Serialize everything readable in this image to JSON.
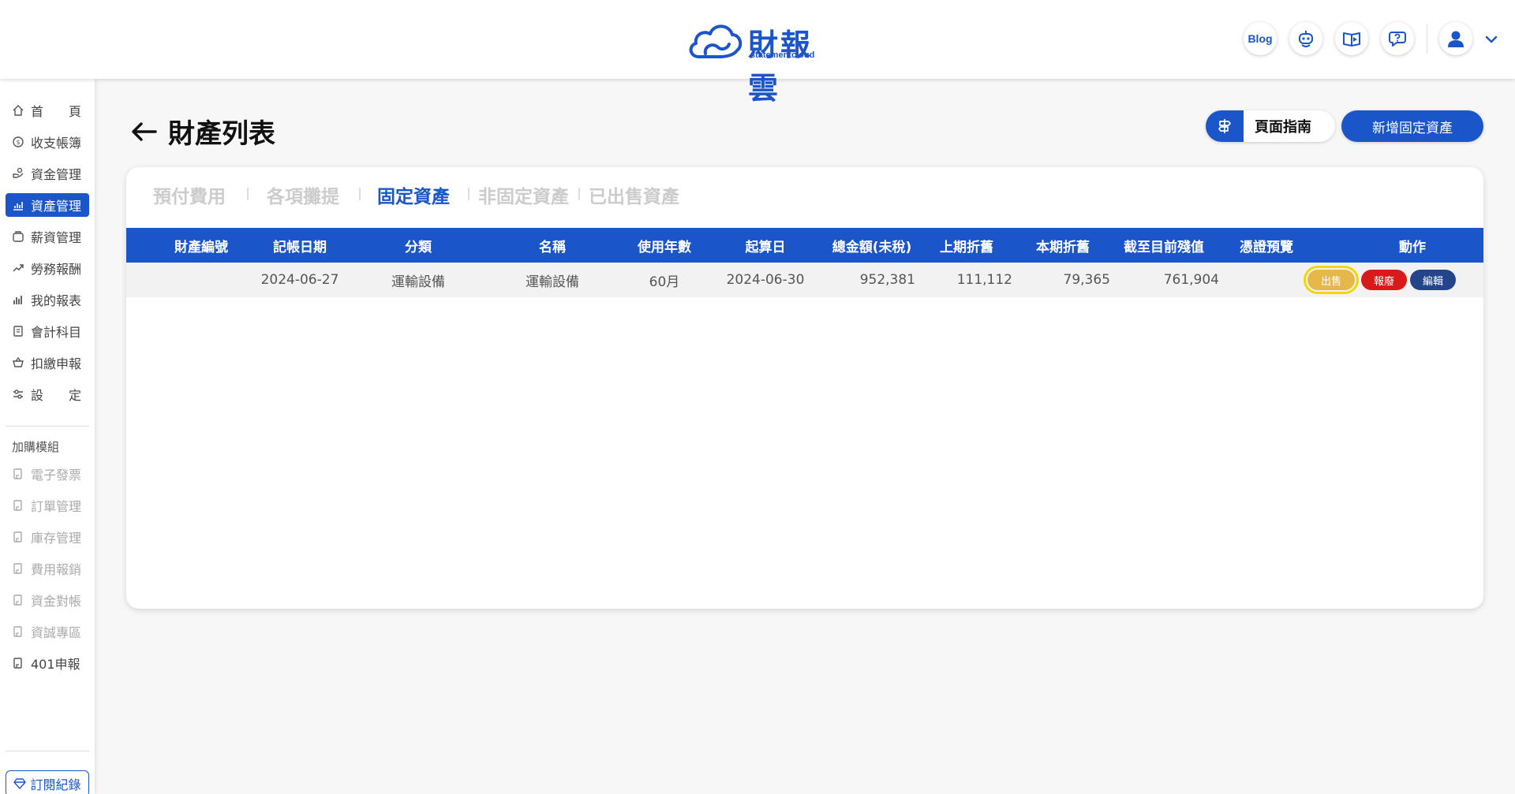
{
  "header": {
    "logo_cn": "財報雲",
    "logo_en": "statementcloud",
    "blog_label": "Blog",
    "icons": [
      "robot-icon",
      "video-book-icon",
      "help-chat-icon",
      "user-avatar-icon",
      "chevron-down-icon"
    ]
  },
  "sidebar": {
    "items": [
      {
        "label_a": "首",
        "label_b": "頁",
        "icon": "home-icon"
      },
      {
        "label": "收支帳簿",
        "icon": "coin-icon"
      },
      {
        "label": "資金管理",
        "icon": "hand-money-icon"
      },
      {
        "label": "資產管理",
        "icon": "chart-icon",
        "active": true
      },
      {
        "label": "薪資管理",
        "icon": "wallet-icon"
      },
      {
        "label": "勞務報酬",
        "icon": "handshake-icon"
      },
      {
        "label": "我的報表",
        "icon": "bar-chart-icon"
      },
      {
        "label": "會計科目",
        "icon": "ledger-icon"
      },
      {
        "label": "扣繳申報",
        "icon": "basket-icon"
      },
      {
        "label_a": "設",
        "label_b": "定",
        "icon": "sliders-icon"
      }
    ],
    "addon_title": "加購模組",
    "addons": [
      {
        "label": "電子發票"
      },
      {
        "label": "訂單管理"
      },
      {
        "label": "庫存管理"
      },
      {
        "label": "費用報銷"
      },
      {
        "label": "資金對帳"
      },
      {
        "label": "資誠專區"
      },
      {
        "label": "401申報"
      }
    ],
    "subscription_label": "訂閱紀錄"
  },
  "page": {
    "title": "財產列表",
    "guide_label": "頁面指南",
    "add_label": "新增固定資產"
  },
  "tabs": [
    {
      "label": "預付費用"
    },
    {
      "label": "各項攤提"
    },
    {
      "label": "固定資產",
      "active": true
    },
    {
      "label": "非固定資產"
    },
    {
      "label": "已出售資產"
    }
  ],
  "table": {
    "columns": [
      "財產編號",
      "記帳日期",
      "分類",
      "名稱",
      "使用年數",
      "起算日",
      "總金額(未稅)",
      "上期折舊",
      "本期折舊",
      "截至目前殘值",
      "憑證預覽",
      "動作"
    ],
    "rows": [
      {
        "asset_no": "",
        "entry_date": "2024-06-27",
        "category": "運輸設備",
        "name": "運輸設備",
        "years": "60月",
        "start_date": "2024-06-30",
        "total": "952,381",
        "prev_dep": "111,112",
        "cur_dep": "79,365",
        "residual": "761,904",
        "voucher": "",
        "actions": {
          "sell": "出售",
          "scrap": "報廢",
          "edit": "編輯"
        }
      }
    ]
  },
  "colors": {
    "primary": "#1a55c9",
    "sell": "#e6b84a",
    "scrap": "#d81a1a",
    "edit": "#24448c"
  }
}
